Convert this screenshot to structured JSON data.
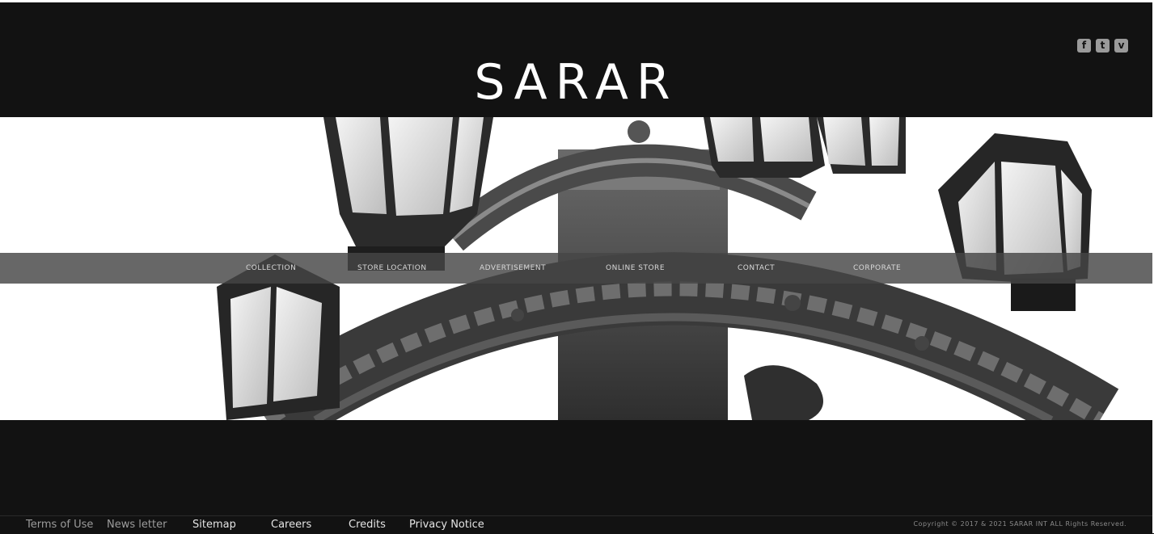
{
  "header": {
    "logo": "SARAR",
    "social": [
      {
        "icon": "facebook-icon",
        "glyph": "f"
      },
      {
        "icon": "twitter-icon",
        "glyph": "t"
      },
      {
        "icon": "vimeo-icon",
        "glyph": "v"
      }
    ]
  },
  "nav": {
    "items": [
      {
        "label": "COLLECTION"
      },
      {
        "label": "STORE LOCATION"
      },
      {
        "label": "ADVERTISEMENT"
      },
      {
        "label": "ONLINE STORE"
      },
      {
        "label": "CONTACT"
      },
      {
        "label": "CORPORATE"
      }
    ]
  },
  "footer": {
    "links": [
      {
        "label": "Terms of Use"
      },
      {
        "label": "News letter"
      },
      {
        "label": "Sitemap"
      },
      {
        "label": "Careers"
      },
      {
        "label": "Credits"
      },
      {
        "label": "Privacy Notice"
      }
    ],
    "copyright": "Copyright © 2017 & 2021 SARAR INT ALL Rights Reserved."
  },
  "colors": {
    "background": "#121212",
    "nav_bar": "#464646",
    "text": "#ffffff"
  }
}
